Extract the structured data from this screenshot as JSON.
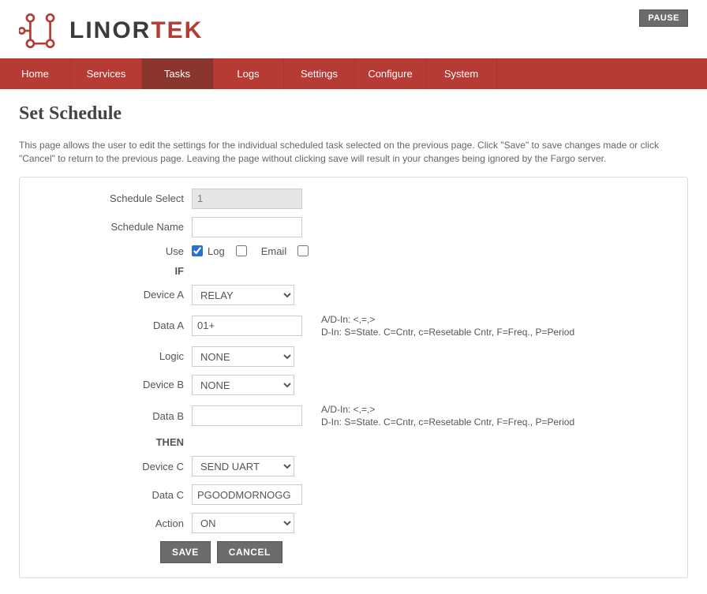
{
  "header": {
    "brand_prefix": "LINOR",
    "brand_suffix": "TEK",
    "pause_label": "PAUSE"
  },
  "nav": {
    "items": [
      {
        "label": "Home"
      },
      {
        "label": "Services"
      },
      {
        "label": "Tasks"
      },
      {
        "label": "Logs"
      },
      {
        "label": "Settings"
      },
      {
        "label": "Configure"
      },
      {
        "label": "System"
      }
    ],
    "active_index": 2
  },
  "page": {
    "title": "Set Schedule",
    "description": "This page allows the user to edit the settings for the individual scheduled task selected on the previous page. Click \"Save\" to save changes made or click \"Cancel\" to return to the previous page. Leaving the page without clicking save will result in your changes being ignored by the Fargo server."
  },
  "form": {
    "schedule_select_label": "Schedule Select",
    "schedule_select_value": "1",
    "schedule_name_label": "Schedule Name",
    "schedule_name_value": "",
    "use_label": "Use",
    "use_checked": true,
    "log_label": "Log",
    "log_checked": false,
    "email_label": "Email",
    "email_checked": false,
    "if_label": "IF",
    "device_a_label": "Device A",
    "device_a_value": "RELAY",
    "data_a_label": "Data A",
    "data_a_value": "01+",
    "data_a_hint_line1": "A/D-In: <,=,>",
    "data_a_hint_line2": "D-In: S=State. C=Cntr, c=Resetable Cntr, F=Freq., P=Period",
    "logic_label": "Logic",
    "logic_value": "NONE",
    "device_b_label": "Device B",
    "device_b_value": "NONE",
    "data_b_label": "Data B",
    "data_b_value": "",
    "data_b_hint_line1": "A/D-In: <,=,>",
    "data_b_hint_line2": "D-In: S=State. C=Cntr, c=Resetable Cntr, F=Freq., P=Period",
    "then_label": "THEN",
    "device_c_label": "Device C",
    "device_c_value": "SEND UART",
    "data_c_label": "Data C",
    "data_c_value": "PGOODMORNOGG",
    "action_label": "Action",
    "action_value": "ON",
    "save_label": "SAVE",
    "cancel_label": "CANCEL"
  }
}
